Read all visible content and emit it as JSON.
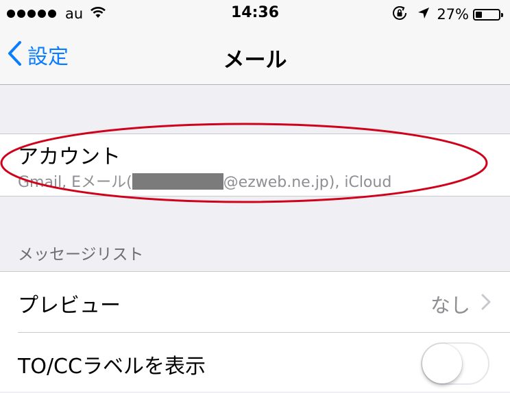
{
  "status_bar": {
    "carrier": "au",
    "time": "14:36",
    "battery_percent": "27%",
    "battery_level": 0.27,
    "icons": [
      "signal-dots-icon",
      "wifi-icon",
      "orientation-lock-icon",
      "location-arrow-icon",
      "battery-icon"
    ]
  },
  "nav": {
    "back_label": "設定",
    "title": "メール"
  },
  "accounts": {
    "title": "アカウント",
    "subtitle_prefix": "Gmail, Eメール(",
    "subtitle_suffix": "@ezweb.ne.jp), iCloud"
  },
  "message_list": {
    "header": "メッセージリスト",
    "rows": [
      {
        "label": "プレビュー",
        "value": "なし"
      },
      {
        "label": "TO/CCラベルを表示",
        "toggle_on": false
      }
    ]
  },
  "colors": {
    "accent": "#0a7cff",
    "highlight_oval": "#d0021b",
    "background": "#efeff4"
  }
}
